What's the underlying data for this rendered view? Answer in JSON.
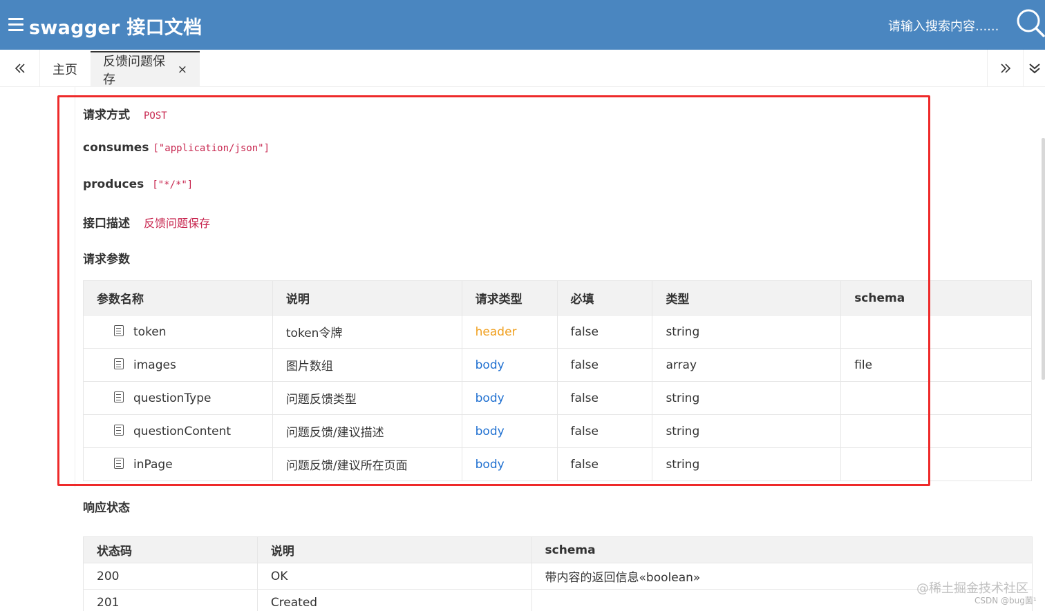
{
  "header": {
    "title": "swagger 接口文档",
    "search_placeholder": "请输入搜索内容......"
  },
  "tabs": {
    "home_label": "主页",
    "active_label": "反馈问题保存",
    "close_glyph": "×"
  },
  "fields": {
    "request_method_label": "请求方式",
    "request_method_value": "POST",
    "consumes_label": "consumes",
    "consumes_value": "[\"application/json\"]",
    "produces_label": "produces",
    "produces_value": "[\"*/*\"]",
    "description_label": "接口描述",
    "description_value": "反馈问题保存"
  },
  "params_section_title": "请求参数",
  "params_table": {
    "headers": [
      "参数名称",
      "说明",
      "请求类型",
      "必填",
      "类型",
      "schema"
    ],
    "rows": [
      {
        "name": "token",
        "desc": "token令牌",
        "in": "header",
        "required": "false",
        "type": "string",
        "schema": ""
      },
      {
        "name": "images",
        "desc": "图片数组",
        "in": "body",
        "required": "false",
        "type": "array",
        "schema": "file"
      },
      {
        "name": "questionType",
        "desc": "问题反馈类型",
        "in": "body",
        "required": "false",
        "type": "string",
        "schema": ""
      },
      {
        "name": "questionContent",
        "desc": "问题反馈/建议描述",
        "in": "body",
        "required": "false",
        "type": "string",
        "schema": ""
      },
      {
        "name": "inPage",
        "desc": "问题反馈/建议所在页面",
        "in": "body",
        "required": "false",
        "type": "string",
        "schema": ""
      }
    ]
  },
  "response_section_title": "响应状态",
  "response_table": {
    "headers": [
      "状态码",
      "说明",
      "schema"
    ],
    "rows": [
      {
        "code": "200",
        "desc": "OK",
        "schema": "带内容的返回信息«boolean»"
      },
      {
        "code": "201",
        "desc": "Created",
        "schema": ""
      }
    ]
  },
  "watermark": "@稀土掘金技术社区",
  "watermark_sub": "CSDN @bug菌¹",
  "colors": {
    "header_bg": "#4a86c0",
    "code_red": "#c7254e",
    "header_loc": "#f0a020",
    "body_loc": "#1e6fd0",
    "highlight_box": "#ee2a2a"
  }
}
